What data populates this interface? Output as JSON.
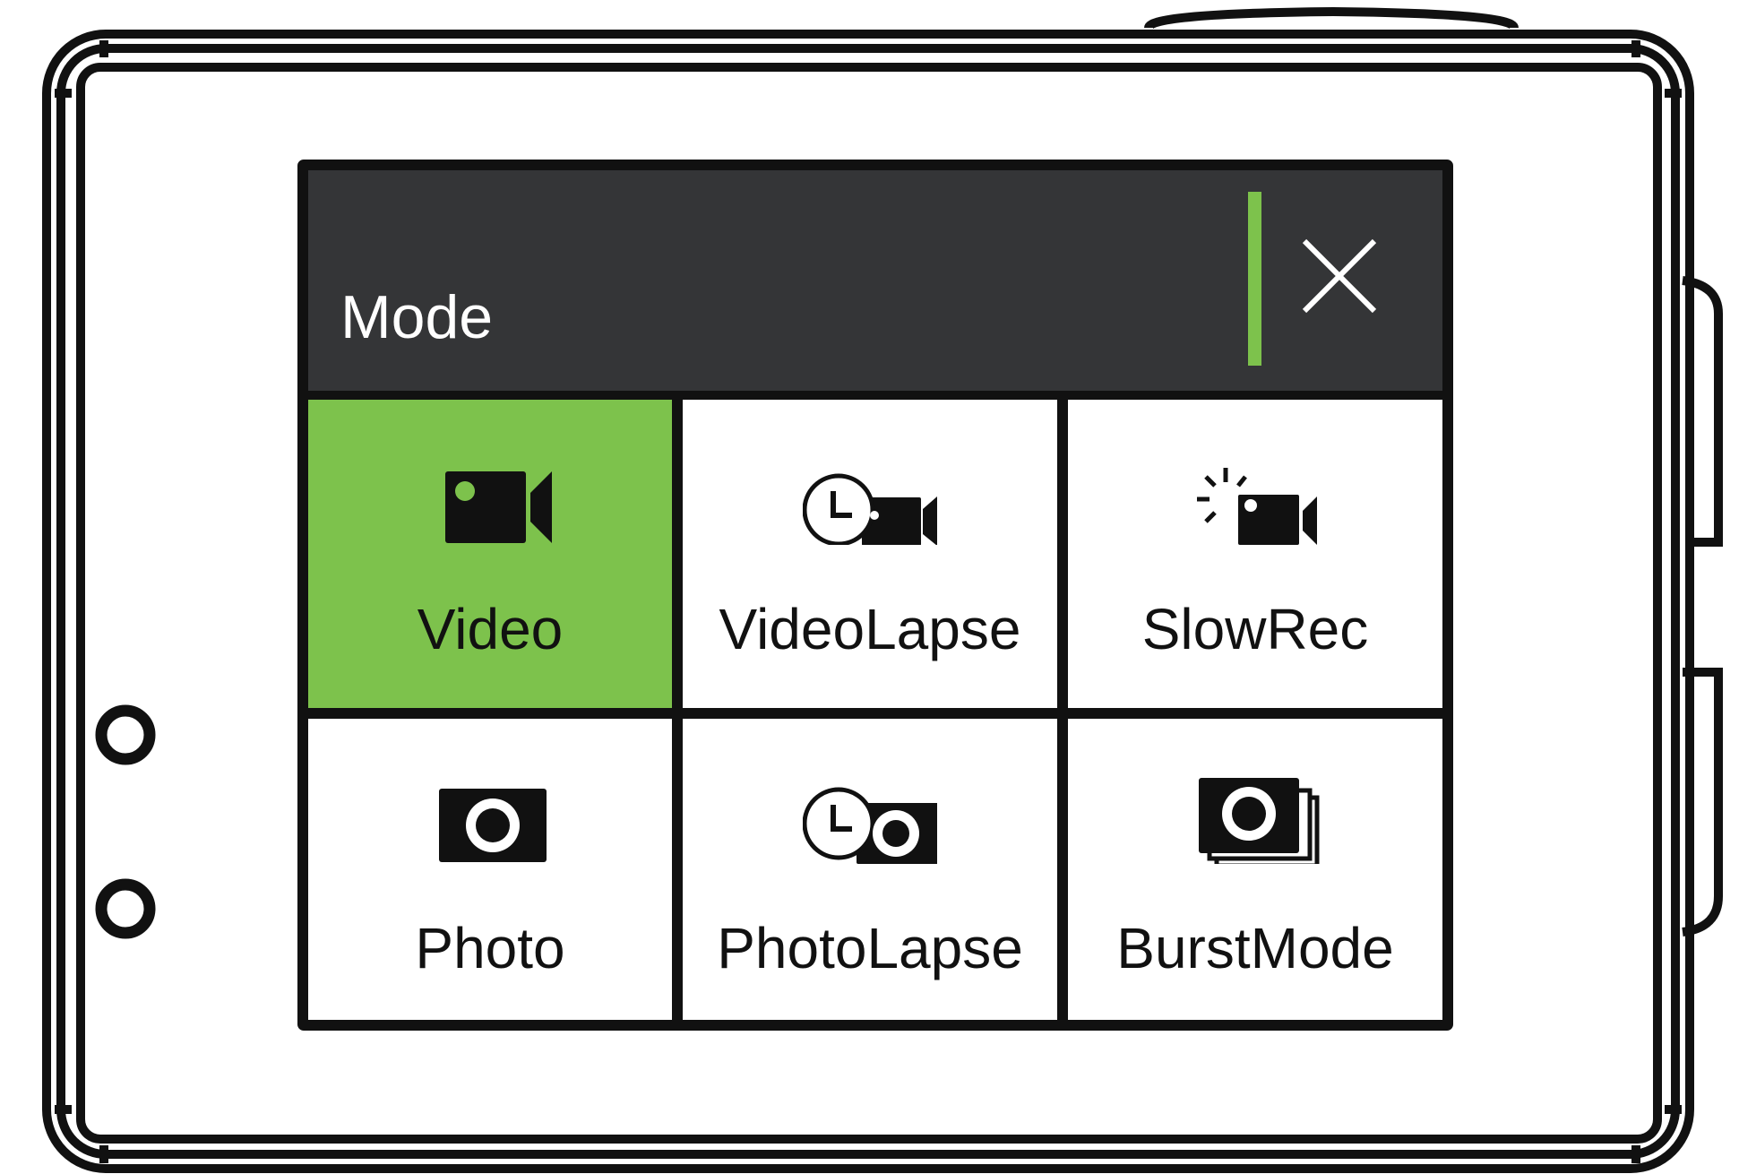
{
  "header": {
    "title": "Mode",
    "close_icon": "close-icon"
  },
  "colors": {
    "accent": "#7dc24c",
    "header_bg": "#343537",
    "outline": "#111111"
  },
  "modes": [
    {
      "label": "Video",
      "icon": "video-camera-icon",
      "selected": true
    },
    {
      "label": "VideoLapse",
      "icon": "video-lapse-icon",
      "selected": false
    },
    {
      "label": "SlowRec",
      "icon": "slow-rec-icon",
      "selected": false
    },
    {
      "label": "Photo",
      "icon": "photo-camera-icon",
      "selected": false
    },
    {
      "label": "PhotoLapse",
      "icon": "photo-lapse-icon",
      "selected": false
    },
    {
      "label": "BurstMode",
      "icon": "burst-mode-icon",
      "selected": false
    }
  ]
}
